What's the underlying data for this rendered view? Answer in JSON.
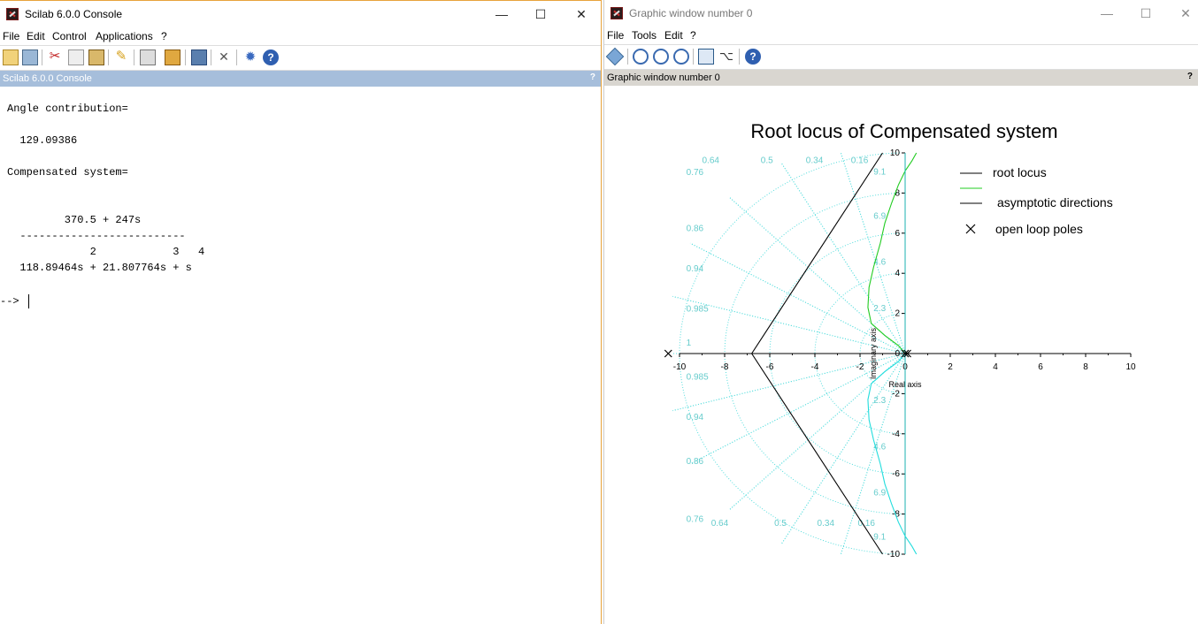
{
  "console_window": {
    "title": "Scilab 6.0.0 Console",
    "window_controls": {
      "minimize": "—",
      "maximize": "☐",
      "close": "✕"
    },
    "menu": [
      "File",
      "Edit",
      "Control",
      "Applications",
      "?"
    ],
    "toolbar_icons": [
      "new-script-icon",
      "open-file-icon",
      "cut-icon",
      "copy-icon",
      "paste-icon",
      "clear-console-icon",
      "print-icon",
      "browse-variables-icon",
      "command-history-icon",
      "preferences-icon",
      "module-manager-icon",
      "help-icon"
    ],
    "dock_title": "Scilab 6.0.0 Console",
    "dock_help": "?",
    "output_lines": [
      "Angle contribution=",
      "",
      "  129.09386",
      "",
      "Compensated system=",
      "",
      "",
      "         370.5 + 247s",
      "  --------------------------",
      "             2            3   4",
      "  118.89464s + 21.807764s + s"
    ],
    "prompt": "-->"
  },
  "graphic_window": {
    "title": "Graphic window number 0",
    "window_controls": {
      "minimize": "—",
      "maximize": "☐",
      "close": "✕"
    },
    "menu": [
      "File",
      "Tools",
      "Edit",
      "?"
    ],
    "toolbar_icons": [
      "rotate-icon",
      "zoom-icon",
      "unzoom-icon",
      "zoom-area-icon",
      "datatip-icon",
      "edit-axes-icon",
      "help-icon"
    ],
    "dock_title": "Graphic window number 0",
    "dock_help": "?"
  },
  "chart_data": {
    "type": "line",
    "title": "Root locus of Compensated system",
    "xlabel": "Real axis",
    "ylabel": "Imaginary axis",
    "xlim": [
      -10,
      10
    ],
    "ylim": [
      -10,
      10
    ],
    "xticks": [
      "-10",
      "-8",
      "-6",
      "-4",
      "-2",
      "0",
      "2",
      "4",
      "6",
      "8",
      "10"
    ],
    "yticks": [
      "-10",
      "-8",
      "-6",
      "-4",
      "-2",
      "0",
      "2",
      "4",
      "6",
      "8",
      "10"
    ],
    "legend_position": "top-right",
    "legend": [
      "root locus",
      "asymptotic directions",
      "open loop poles"
    ],
    "colors": {
      "branch_upper": "#22cc22",
      "branch_lower": "#22dddd",
      "asymptote": "#000000",
      "grid": "#55dddd",
      "grid_label": "#66cccc"
    },
    "damping_labels": [
      "0.76",
      "0.64",
      "0.5",
      "0.34",
      "0.16",
      "0.86",
      "0.94",
      "0.985",
      "1"
    ],
    "frequency_labels": [
      "9.1",
      "6.9",
      "4.6",
      "2.3"
    ],
    "series": [
      {
        "points": [
          [
            0,
            0
          ],
          [
            -0.3,
            0.4
          ],
          [
            -0.9,
            0.9
          ],
          [
            -1.5,
            1.5
          ],
          [
            -1.65,
            2.3
          ],
          [
            -1.6,
            3.3
          ],
          [
            -1.4,
            4.3
          ],
          [
            -1.1,
            5.5
          ],
          [
            -0.9,
            6.5
          ],
          [
            -0.6,
            7.5
          ],
          [
            -0.3,
            8.4
          ],
          [
            0,
            9.1
          ],
          [
            0.3,
            9.6
          ],
          [
            0.5,
            10
          ]
        ]
      },
      {
        "points": [
          [
            0,
            0
          ],
          [
            -0.3,
            -0.4
          ],
          [
            -0.9,
            -0.9
          ],
          [
            -1.5,
            -1.5
          ],
          [
            -1.65,
            -2.3
          ],
          [
            -1.6,
            -3.3
          ],
          [
            -1.4,
            -4.3
          ],
          [
            -1.1,
            -5.5
          ],
          [
            -0.9,
            -6.5
          ],
          [
            -0.6,
            -7.5
          ],
          [
            -0.3,
            -8.4
          ],
          [
            0,
            -9.1
          ],
          [
            0.3,
            -9.6
          ],
          [
            0.5,
            -10
          ]
        ]
      },
      {
        "points": [
          [
            -6.8,
            0
          ],
          [
            -1.0,
            10
          ]
        ]
      },
      {
        "points": [
          [
            -6.8,
            0
          ],
          [
            -1.0,
            -10
          ]
        ]
      },
      {
        "points": [
          [
            0,
            10
          ],
          [
            0,
            -10
          ]
        ]
      }
    ],
    "poles": [
      [
        0,
        0
      ],
      [
        0.1,
        0
      ],
      [
        -10.5,
        0
      ]
    ]
  }
}
